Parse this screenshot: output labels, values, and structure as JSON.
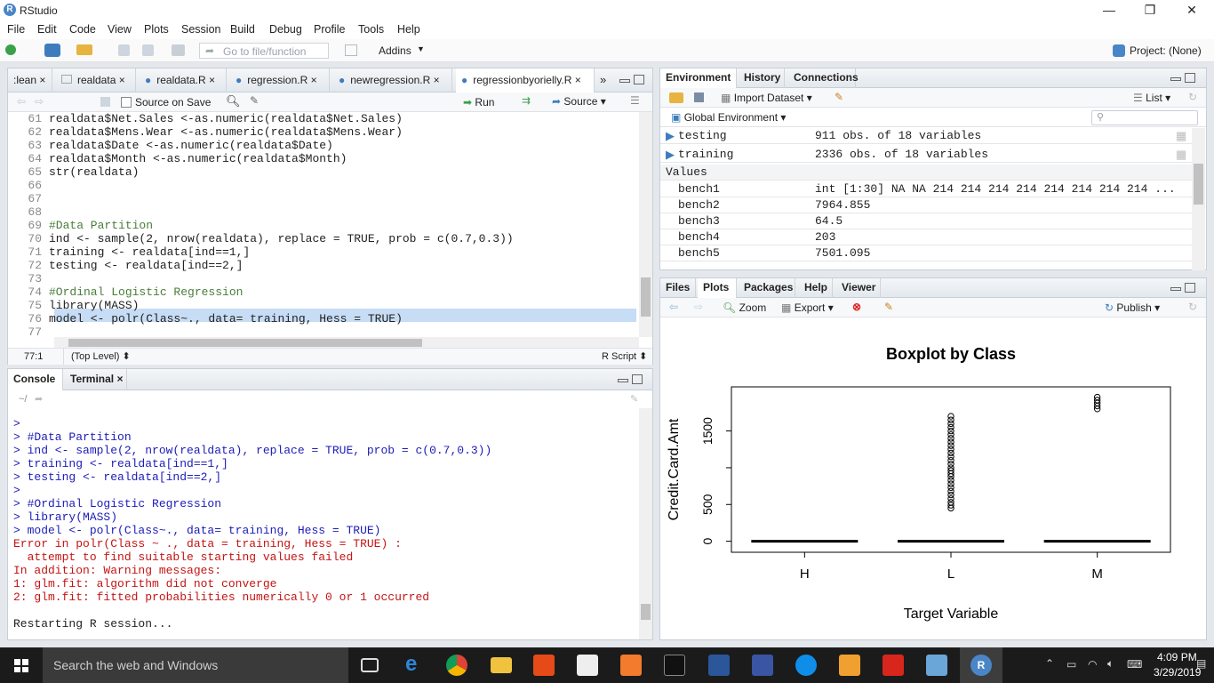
{
  "window": {
    "title": "RStudio",
    "min": "—",
    "max": "❐",
    "close": "✕"
  },
  "menu": [
    "File",
    "Edit",
    "Code",
    "View",
    "Plots",
    "Session",
    "Build",
    "Debug",
    "Profile",
    "Tools",
    "Help"
  ],
  "toolbar": {
    "goto_placeholder": "Go to file/function",
    "addins": "Addins",
    "project": "Project: (None)"
  },
  "editor": {
    "tabs": [
      ":lean",
      "realdata",
      "realdata.R",
      "regression.R",
      "newregression.R",
      "regressionbyorielly.R"
    ],
    "source_on_save": "Source on Save",
    "run": "Run",
    "source": "Source",
    "lines": [
      {
        "n": "61",
        "t": "realdata$Net.Sales <-as.numeric(realdata$Net.Sales)"
      },
      {
        "n": "62",
        "t": "realdata$Mens.Wear <-as.numeric(realdata$Mens.Wear)"
      },
      {
        "n": "63",
        "t": "realdata$Date <-as.numeric(realdata$Date)"
      },
      {
        "n": "64",
        "t": "realdata$Month <-as.numeric(realdata$Month)"
      },
      {
        "n": "65",
        "t": "str(realdata)"
      },
      {
        "n": "66",
        "t": ""
      },
      {
        "n": "67",
        "t": ""
      },
      {
        "n": "68",
        "t": ""
      },
      {
        "n": "69",
        "t": "#Data Partition"
      },
      {
        "n": "70",
        "t": "ind <- sample(2, nrow(realdata), replace = TRUE, prob = c(0.7,0.3))"
      },
      {
        "n": "71",
        "t": "training <- realdata[ind==1,]"
      },
      {
        "n": "72",
        "t": "testing <- realdata[ind==2,]"
      },
      {
        "n": "73",
        "t": ""
      },
      {
        "n": "74",
        "t": "#Ordinal Logistic Regression"
      },
      {
        "n": "75",
        "t": "library(MASS)"
      },
      {
        "n": "76",
        "t": "model <- polr(Class~., data= training, Hess = TRUE)"
      },
      {
        "n": "77",
        "t": ""
      }
    ],
    "status_pos": "77:1",
    "status_level": "(Top Level) ⬍",
    "status_type": "R Script ⬍"
  },
  "console": {
    "tabs": [
      "Console",
      "Terminal"
    ],
    "path": "~/",
    "lines": [
      {
        "t": ">",
        "c": "blue"
      },
      {
        "t": "> #Data Partition",
        "c": "blue"
      },
      {
        "t": "> ind <- sample(2, nrow(realdata), replace = TRUE, prob = c(0.7,0.3))",
        "c": "blue"
      },
      {
        "t": "> training <- realdata[ind==1,]",
        "c": "blue"
      },
      {
        "t": "> testing <- realdata[ind==2,]",
        "c": "blue"
      },
      {
        "t": ">",
        "c": "blue"
      },
      {
        "t": "> #Ordinal Logistic Regression",
        "c": "blue"
      },
      {
        "t": "> library(MASS)",
        "c": "blue"
      },
      {
        "t": "> model <- polr(Class~., data= training, Hess = TRUE)",
        "c": "blue"
      },
      {
        "t": "Error in polr(Class ~ ., data = training, Hess = TRUE) :",
        "c": "red"
      },
      {
        "t": "  attempt to find suitable starting values failed",
        "c": "red"
      },
      {
        "t": "In addition: Warning messages:",
        "c": "red"
      },
      {
        "t": "1: glm.fit: algorithm did not converge",
        "c": "red"
      },
      {
        "t": "2: glm.fit: fitted probabilities numerically 0 or 1 occurred",
        "c": "red"
      },
      {
        "t": "",
        "c": "blue"
      },
      {
        "t": "Restarting R session...",
        "c": "black"
      }
    ]
  },
  "env": {
    "tabs": [
      "Environment",
      "History",
      "Connections"
    ],
    "import": "Import Dataset",
    "list": "List",
    "global": "Global Environment",
    "data": [
      {
        "name": "testing",
        "val": "911 obs. of 18 variables"
      },
      {
        "name": "training",
        "val": "2336 obs. of 18 variables"
      }
    ],
    "values_header": "Values",
    "values": [
      {
        "name": "bench1",
        "val": "int [1:30] NA NA 214 214 214 214 214 214 214 214 ..."
      },
      {
        "name": "bench2",
        "val": "7964.855"
      },
      {
        "name": "bench3",
        "val": "64.5"
      },
      {
        "name": "bench4",
        "val": "203"
      },
      {
        "name": "bench5",
        "val": "7501.095"
      }
    ]
  },
  "files": {
    "tabs": [
      "Files",
      "Plots",
      "Packages",
      "Help",
      "Viewer"
    ],
    "zoom": "Zoom",
    "export": "Export",
    "publish": "Publish"
  },
  "chart_data": {
    "type": "box",
    "title": "Boxplot by Class",
    "xlabel": "Target Variable",
    "ylabel": "Credit.Card.Amt",
    "categories": [
      "H",
      "L",
      "M"
    ],
    "yticks": [
      "0",
      "500",
      "1500"
    ],
    "ylim": [
      0,
      2000
    ],
    "medians": [
      0,
      0,
      0
    ],
    "outliers": [
      [],
      [
        450,
        490,
        530,
        580,
        630,
        680,
        730,
        780,
        830,
        880,
        920,
        960,
        1000,
        1050,
        1100,
        1150,
        1200,
        1250,
        1300,
        1350,
        1400,
        1450,
        1500,
        1550,
        1600,
        1650,
        1700
      ],
      [
        1800,
        1840,
        1880,
        1920,
        1960
      ]
    ]
  },
  "taskbar": {
    "search": "Search the web and Windows",
    "time": "4:09 PM",
    "date": "3/29/2019"
  }
}
